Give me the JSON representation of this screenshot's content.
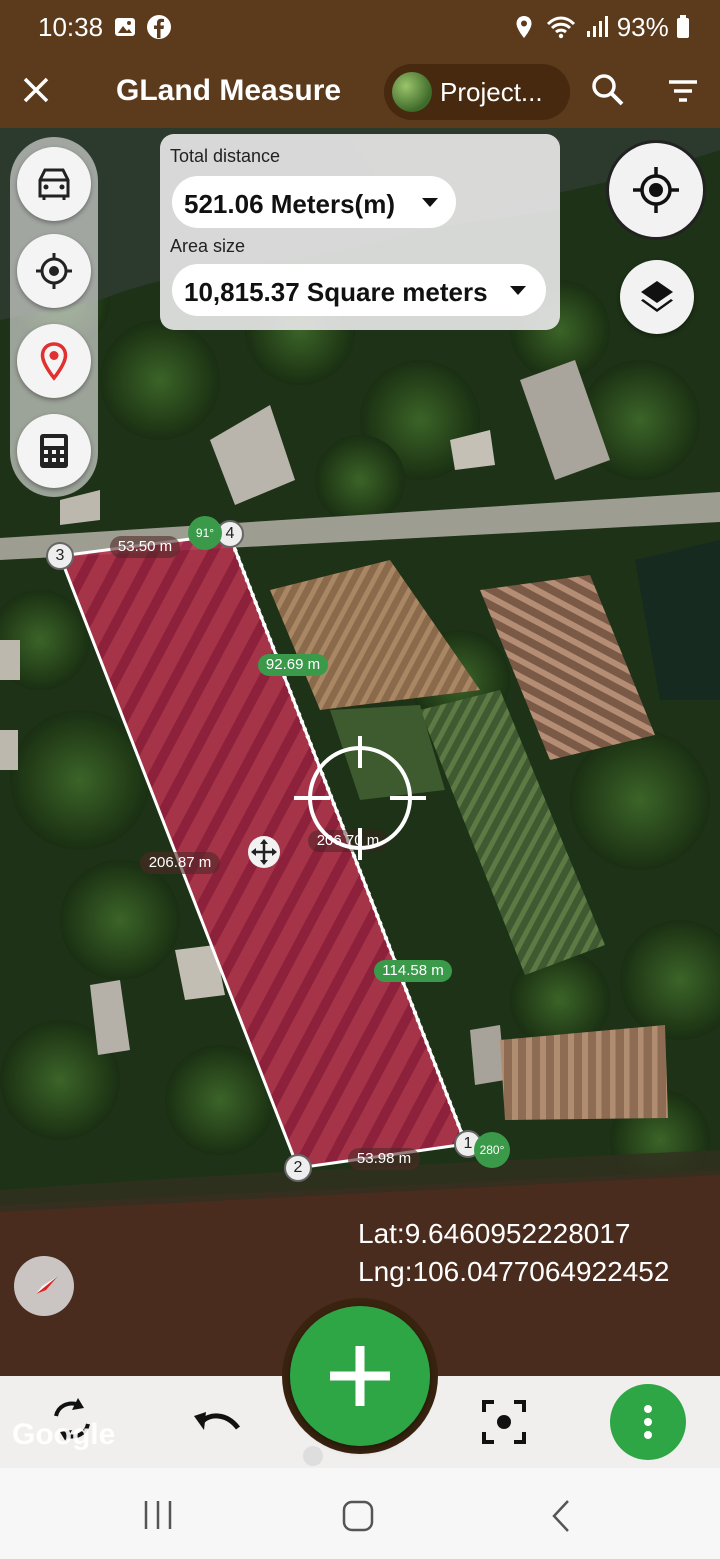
{
  "status_bar": {
    "time": "10:38",
    "battery": "93%",
    "icons": [
      "image-icon",
      "facebook-icon",
      "location-icon",
      "wifi-icon",
      "signal-icon",
      "battery-icon"
    ]
  },
  "app_bar": {
    "close_icon": "close-icon",
    "title": "GLand Measure",
    "project_label": "Project...",
    "search_icon": "search-icon",
    "filter_icon": "filter-icon"
  },
  "measure": {
    "distance_label": "Total distance",
    "distance_value": "521.06 Meters(m)",
    "area_label": "Area size",
    "area_value": "10,815.37 Square meters"
  },
  "side_tools": [
    "car-icon",
    "target-icon",
    "map-pin-icon",
    "calculator-icon"
  ],
  "polygon": {
    "fill_color": "#c0224a",
    "vertex_labels": [
      "1",
      "2",
      "3",
      "4"
    ],
    "edge_labels": [
      "53.50 m",
      "206.87 m",
      "53.98 m",
      "206.70 m"
    ],
    "dotted_labels": [
      "92.69 m",
      "114.58 m"
    ],
    "angle_labels": [
      "91°",
      "280°"
    ]
  },
  "coords": {
    "lat": "Lat:9.6460952228017",
    "lng": "Lng:106.0477064922452"
  },
  "map_attribution": "Google",
  "bottom_bar": {
    "buttons": [
      "refresh-icon",
      "undo-icon",
      "add-icon",
      "focus-icon",
      "more-icon"
    ]
  },
  "nav_bar": [
    "recents-icon",
    "home-icon",
    "back-icon"
  ],
  "colors": {
    "app_bar": "#5c3a1c",
    "accent_green": "#2fa646",
    "label_green": "#3a9a4a"
  }
}
